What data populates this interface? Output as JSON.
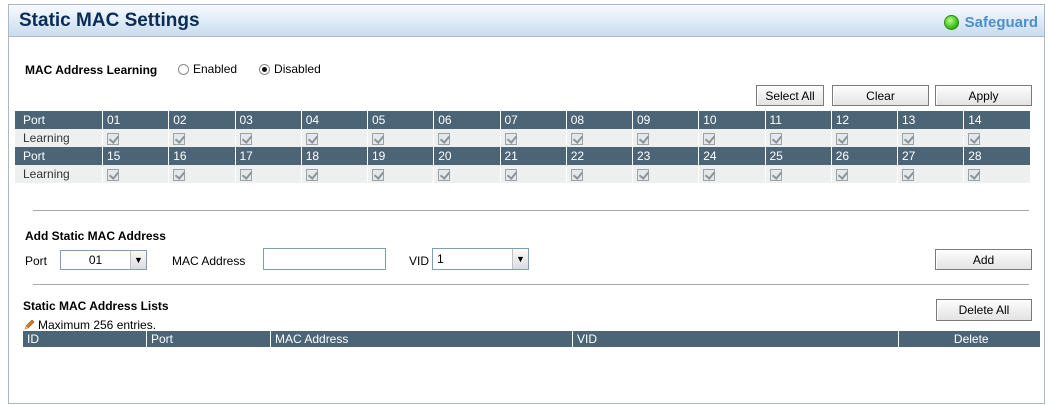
{
  "header": {
    "title": "Static MAC Settings",
    "safeguard_label": "Safeguard",
    "safeguard_color": "#3fbf1f"
  },
  "mac_learning": {
    "label": "MAC Address Learning",
    "options": [
      {
        "label": "Enabled",
        "checked": false
      },
      {
        "label": "Disabled",
        "checked": true
      }
    ]
  },
  "top_buttons": {
    "select_all": "Select All",
    "clear": "Clear",
    "apply": "Apply"
  },
  "port_table": {
    "port_label": "Port",
    "learning_label": "Learning",
    "rows": [
      {
        "ports": [
          "01",
          "02",
          "03",
          "04",
          "05",
          "06",
          "07",
          "08",
          "09",
          "10",
          "11",
          "12",
          "13",
          "14"
        ]
      },
      {
        "ports": [
          "15",
          "16",
          "17",
          "18",
          "19",
          "20",
          "21",
          "22",
          "23",
          "24",
          "25",
          "26",
          "27",
          "28"
        ]
      }
    ]
  },
  "add_section": {
    "title": "Add Static MAC Address",
    "port_label": "Port",
    "port_value": "01",
    "mac_label": "MAC Address",
    "mac_value": "",
    "vid_label": "VID",
    "vid_value": "1",
    "add_button": "Add"
  },
  "list_section": {
    "title": "Static MAC Address Lists",
    "note": "Maximum 256 entries.",
    "delete_all": "Delete All",
    "columns": [
      "ID",
      "Port",
      "MAC Address",
      "VID",
      "Delete"
    ]
  }
}
